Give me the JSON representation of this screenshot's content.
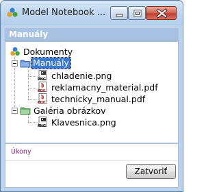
{
  "window": {
    "title": "Model Notebook ..."
  },
  "header": {
    "title": "Manuály"
  },
  "tree": {
    "root": {
      "label": "Dokumenty",
      "icon": "tortoisesvn-icon"
    },
    "folders": [
      {
        "label": "Manuály",
        "icon": "blue-folder-icon",
        "selected": true,
        "files": [
          {
            "label": "chladenie.png",
            "icon": "png-file-icon"
          },
          {
            "label": "reklamacny_material.pdf",
            "icon": "pdf-file-icon"
          },
          {
            "label": "technicky_manual.pdf",
            "icon": "pdf-file-icon"
          }
        ]
      },
      {
        "label": "Galéria obrázkov",
        "icon": "green-folder-icon",
        "selected": false,
        "files": [
          {
            "label": "Klavesnica.png",
            "icon": "png-file-icon"
          }
        ]
      }
    ]
  },
  "actions": {
    "label": "Úkony",
    "close_label": "Zatvoriť"
  },
  "colors": {
    "selection": "#3a79d4",
    "header_bar": "#a8c2e3",
    "window_frame": "#bcd3ee",
    "actions_label": "#8a1e8a",
    "close_button": "#c0402b"
  }
}
